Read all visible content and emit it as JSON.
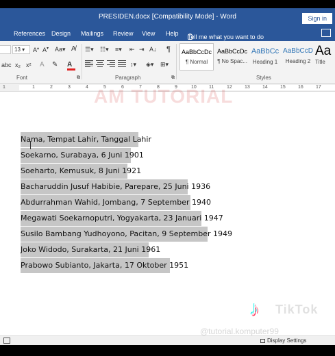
{
  "window": {
    "title": "PRESIDEN.docx [Compatibility Mode] - Word",
    "signin_label": "Sign in"
  },
  "tabs": [
    "References",
    "Design",
    "Mailings",
    "Review",
    "View",
    "Help"
  ],
  "tell_me": "Tell me what you want to do",
  "font": {
    "name": "",
    "size": "13",
    "group_label": "Font",
    "font_color": "#e02020"
  },
  "paragraph": {
    "group_label": "Paragraph"
  },
  "styles": {
    "group_label": "Styles",
    "items": [
      {
        "sample": "AaBbCcDc",
        "name": "¶ Normal"
      },
      {
        "sample": "AaBbCcDc",
        "name": "¶ No Spac..."
      },
      {
        "sample": "AaBbCc",
        "name": "Heading 1"
      },
      {
        "sample": "AaBbCcD",
        "name": "Heading 2"
      },
      {
        "sample": "Aa",
        "name": "Title"
      }
    ]
  },
  "ruler": {
    "numbers": [
      "1",
      "1",
      "2",
      "3",
      "4",
      "5",
      "6",
      "7",
      "8",
      "9",
      "10",
      "11",
      "12",
      "13",
      "14",
      "15",
      "16",
      "17"
    ]
  },
  "watermark": "AM TUTORIAL",
  "document": {
    "lines": [
      "Nama, Tempat Lahir, Tanggal Lahir",
      "Soekarno, Surabaya, 6 Juni 1901",
      "Soeharto, Kemusuk, 8 Juni 1921",
      "Bacharuddin Jusuf Habibie, Parepare, 25 Juni 1936",
      "Abdurrahman Wahid, Jombang, 7 September 1940",
      "Megawati Soekarnoputri, Yogyakarta, 23 Januari 1947",
      "Susilo Bambang Yudhoyono, Pacitan, 9 September 1949",
      "Joko Widodo, Surakarta, 21 Juni 1961",
      "Prabowo Subianto, Jakarta, 17 Oktober 1951"
    ]
  },
  "overlay": {
    "brand": "TikTok",
    "handle": "@tutorial.komputer99"
  },
  "status": {
    "display_settings": "Display Settings"
  }
}
